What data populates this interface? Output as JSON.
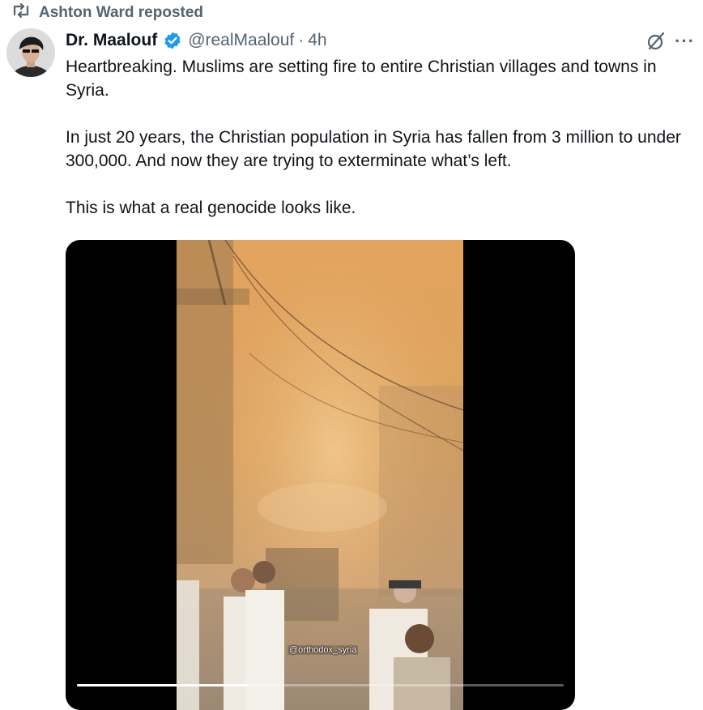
{
  "repost": {
    "text": "Ashton Ward reposted",
    "icon": "repost-icon"
  },
  "author": {
    "display_name": "Dr. Maalouf",
    "handle": "@realMaalouf",
    "separator": "·",
    "time": "4h",
    "verified_icon": "verified-badge-icon",
    "verified_color": "#1d9bf0",
    "avatar_icon": "avatar"
  },
  "actions": {
    "grok_icon": "grok-icon",
    "more_label": "···"
  },
  "tweet": {
    "paragraphs": [
      "Heartbreaking. Muslims are setting fire to entire Christian villages and towns in Syria.",
      "In just 20 years, the Christian population in Syria has fallen from 3 million to under 300,000. And now they are trying to exterminate what’s left.",
      "This is what a real genocide looks like."
    ]
  },
  "media": {
    "watermark": "@orthodox_syria",
    "progress": 0.35,
    "accent_color": "#d9a45f"
  }
}
